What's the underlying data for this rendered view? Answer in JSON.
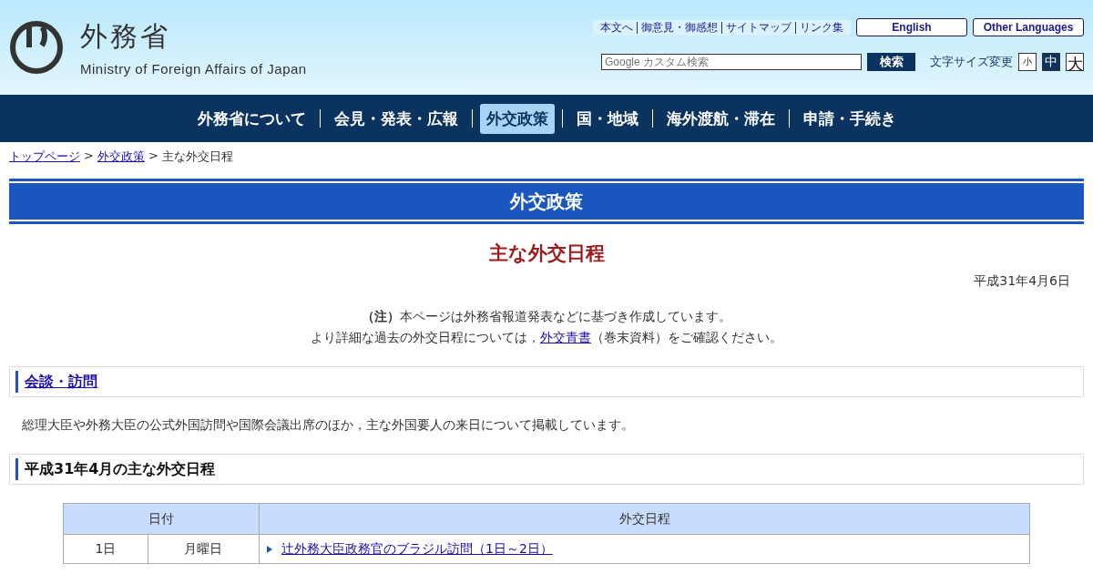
{
  "header": {
    "logo_title": "外務省",
    "logo_subtitle": "Ministry of Foreign Affairs of Japan",
    "utility_links": [
      "本文へ",
      "御意見・御感想",
      "サイトマップ",
      "リンク集"
    ],
    "language_buttons": [
      "English",
      "Other Languages"
    ],
    "search": {
      "placeholder": "Google カスタム検索",
      "button": "検索"
    },
    "font_size": {
      "label": "文字サイズ変更",
      "options": [
        {
          "label": "小",
          "selected": false
        },
        {
          "label": "中",
          "selected": true
        },
        {
          "label": "大",
          "selected": false
        }
      ]
    }
  },
  "nav": [
    {
      "label": "外務省について",
      "selected": false
    },
    {
      "label": "会見・発表・広報",
      "selected": false
    },
    {
      "label": "外交政策",
      "selected": true
    },
    {
      "label": "国・地域",
      "selected": false
    },
    {
      "label": "海外渡航・滞在",
      "selected": false
    },
    {
      "label": "申請・手続き",
      "selected": false
    }
  ],
  "breadcrumb": {
    "links": [
      "トップページ",
      "外交政策"
    ],
    "separator": ">",
    "current": "主な外交日程"
  },
  "section_banner": "外交政策",
  "page_title": "主な外交日程",
  "date": "平成31年4月6日",
  "note": {
    "line1": "**（注）**本ページは外務省報道発表などに基づき作成しています。",
    "line2_before": "より詳細な過去の外交日程については，",
    "line2_link": "外交青書",
    "line2_after": "（巻末資料）をご確認ください。"
  },
  "sections": [
    {
      "heading": "会談・訪問",
      "link": true,
      "text": "総理大臣や外務大臣の公式外国訪問や国際会議出席のほか，主な外国要人の来日について掲載しています。"
    },
    {
      "heading": "平成31年4月の主な外交日程",
      "link": false
    }
  ],
  "table": {
    "columns": [
      "日付",
      "外交日程"
    ],
    "rows": [
      {
        "day": "1日",
        "weekday": "月曜日",
        "event": "辻外務大臣政務官のブラジル訪問（1日～2日）"
      }
    ]
  }
}
